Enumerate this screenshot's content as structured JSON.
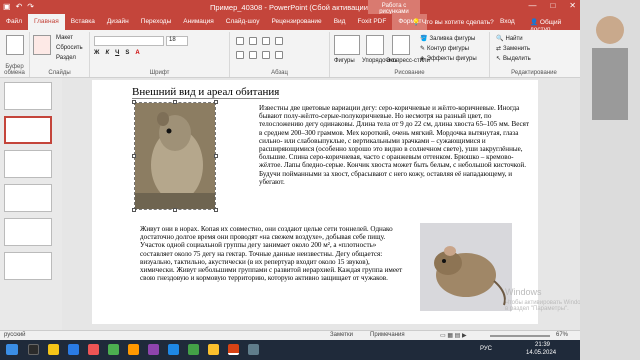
{
  "window": {
    "title": "Пример_40308 - PowerPoint (Сбой активации продукта)",
    "context_label": "Работа с рисунками",
    "min_label": "—",
    "max_label": "□",
    "close_label": "✕"
  },
  "tabs": [
    "Файл",
    "Главная",
    "Вставка",
    "Дизайн",
    "Переходы",
    "Анимация",
    "Слайд-шоу",
    "Рецензирование",
    "Вид",
    "Foxit PDF",
    "Формат"
  ],
  "active_tab": "Главная",
  "tellme": "Что вы хотите сделать?",
  "signin": "Вход",
  "share": "Общий доступ",
  "ribbon": {
    "groups": [
      "Буфер обмена",
      "Слайды",
      "Шрифт",
      "Абзац",
      "Рисование",
      "Редактирование"
    ],
    "paste": "Вставить",
    "create_slide": "Создать слайд",
    "layout": "Макет",
    "reset": "Сбросить",
    "section": "Раздел",
    "font_size": "18",
    "shapes": "Фигуры",
    "arrange": "Упорядочить",
    "express": "Экспресс-стили",
    "fill": "Заливка фигуры",
    "outline": "Контур фигуры",
    "effects": "Эффекты фигуры",
    "find": "Найти",
    "replace": "Заменить",
    "select": "Выделить"
  },
  "slide": {
    "heading": "Внешний вид и ареал обитания",
    "para1": "Известны две цветовые вариации дегу: серо-коричневые и жёлто-коричневые. Иногда бывают полу-жёлто-серые-полукоричневые. Но несмотря на разный цвет, по телосложению дегу одинаковы. Длина тела от 9 до 22 см, длина хвоста 65–105 мм. Весят в среднем 200–300 граммов. Мех короткий, очень мягкий. Мордочка вытянутая, глаза сильно- или слабовыпуклые, с вертикальными зрачками – сужающимися и расширяющимися (особенно хорошо это видно в солнечном свете), уши закруглённые, большие. Спина серо-коричневая, часто с оранжевым оттенком. Брюшко – кремово-жёлтое. Лапы бледно-серые. Кончик хвоста может быть белым, с небольшой кисточкой. Будучи пойманными за хвост, сбрасывают с него кожу, оставляя её нападающему, и убегают.",
    "para2": "Живут они в норах. Копая их совместно, они создают целые сети тоннелей. Однако достаточно долгое время они проводят «на свежем воздухе», добывая себе пищу. Участок одной социальной группы дегу занимает около 200 м², а «плотность» составляет около 75 дегу на гектар. Точные данные неизвестны. Дегу общается: визуально, тактильно, акустически (в их репертуар входит около 15 звуков), химически. Живут небольшими группами с развитой иерархией. Каждая группа имеет свою гнездовую и кормовую территорию, которую активно защищает от чужаков."
  },
  "status": {
    "lang": "русский",
    "notes": "Заметки",
    "comments": "Примечания",
    "zoom": "67%"
  },
  "watermark": {
    "line1": "Windows",
    "line2": "Чтобы активировать Windows, перейдите в раздел \"Параметры\"."
  },
  "taskbar": {
    "search_placeholder": "Поиск",
    "temp": "10°C",
    "time": "21:39",
    "date": "14.05.2024",
    "lang": "РУС"
  }
}
